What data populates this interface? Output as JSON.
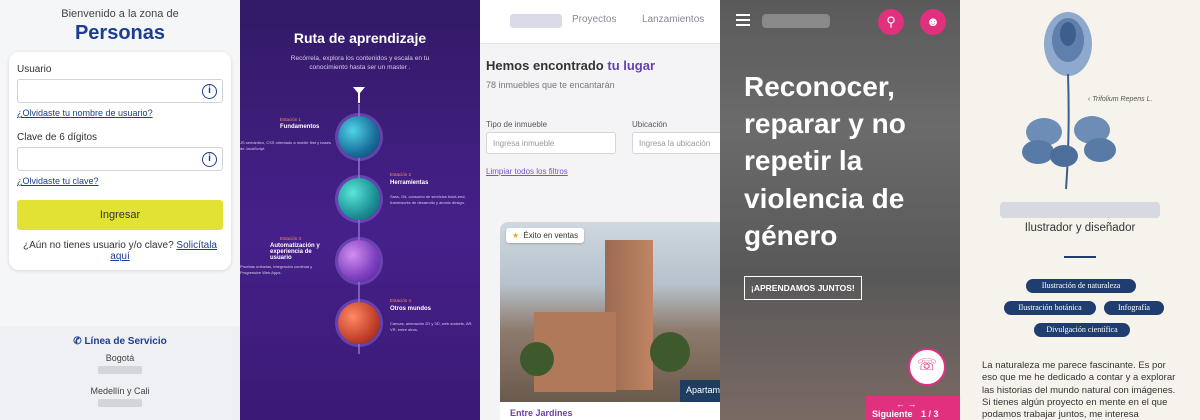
{
  "login": {
    "welcome": "Bienvenido a la zona de",
    "title": "Personas",
    "user_label": "Usuario",
    "forgot_user": "¿Olvidaste tu nombre de usuario?",
    "pin_label": "Clave de 6 dígitos",
    "forgot_pin": "¿Olvidaste tu clave?",
    "submit": "Ingresar",
    "no_account": "¿Aún no tienes usuario y/o clave?",
    "request": "Solicítala aquí",
    "service_title": "Línea de Servicio",
    "cities": [
      "Bogotá",
      "Medellín y Cali"
    ]
  },
  "learning": {
    "title": "Ruta de aprendizaje",
    "subtitle": "Recórrela, explora los contenidos y escala en tu conocimiento hasta ser un master .",
    "stages": [
      {
        "label": "Estación 1",
        "name": "Fundamentos",
        "desc": "JS semántico, CSS orientado a mobile first y bases de JavaScript."
      },
      {
        "label": "Estación 2",
        "name": "Herramientas",
        "desc": "Sass, Git, consumo de servicios back-end, frameworks de desarrollo y atomic design."
      },
      {
        "label": "Estación 3",
        "name": "Automatización y experiencia de usuario",
        "desc": "Pruebas unitarias, integración continua y Progressive Web Apps."
      },
      {
        "label": "Estación 4",
        "name": "Otros mundos",
        "desc": "Canvas, animación 2D y 3D, web sockets, AR, VR, entre otros."
      }
    ]
  },
  "realestate": {
    "nav": [
      "Proyectos",
      "Lanzamientos"
    ],
    "found_prefix": "Hemos encontrado",
    "found_highlight": "tu lugar",
    "count": "78 inmuebles que te encantarán",
    "type_label": "Tipo de inmueble",
    "type_placeholder": "Ingresa inmueble",
    "location_label": "Ubicación",
    "location_placeholder": "Ingresa la ubicación",
    "clear": "Limpiar todos los filtros",
    "badge": "Éxito en ventas",
    "ribbon": "Apartamentos",
    "project": "Entre Jardines"
  },
  "campaign": {
    "headline": "Reconocer, reparar y no repetir la violencia de género",
    "cta": "¡APRENDAMOS JUNTOS!",
    "next": "Siguiente",
    "page": "1 / 3",
    "arrows": "← →"
  },
  "portfolio": {
    "caption": "Trifolium Repens L.",
    "role": "Ilustrador y diseñador",
    "tags": [
      "Ilustración de naturaleza",
      "Ilustración botánica",
      "Infografía",
      "Divulgación científica"
    ],
    "bio": "La naturaleza me parece fascinante. Es por eso que me he dedicado a contar y a explorar las historias del mundo natural con imágenes. Si tienes algún proyecto en mente en el que podamos trabajar juntos, me interesa"
  },
  "colors": {
    "brand_blue": "#1d3e8f",
    "login_button": "#e2e234",
    "learning_bg": "#46208a",
    "realestate_accent": "#6a3fb0",
    "campaign_pink": "#e0307e",
    "portfolio_navy": "#1f3d6e"
  }
}
